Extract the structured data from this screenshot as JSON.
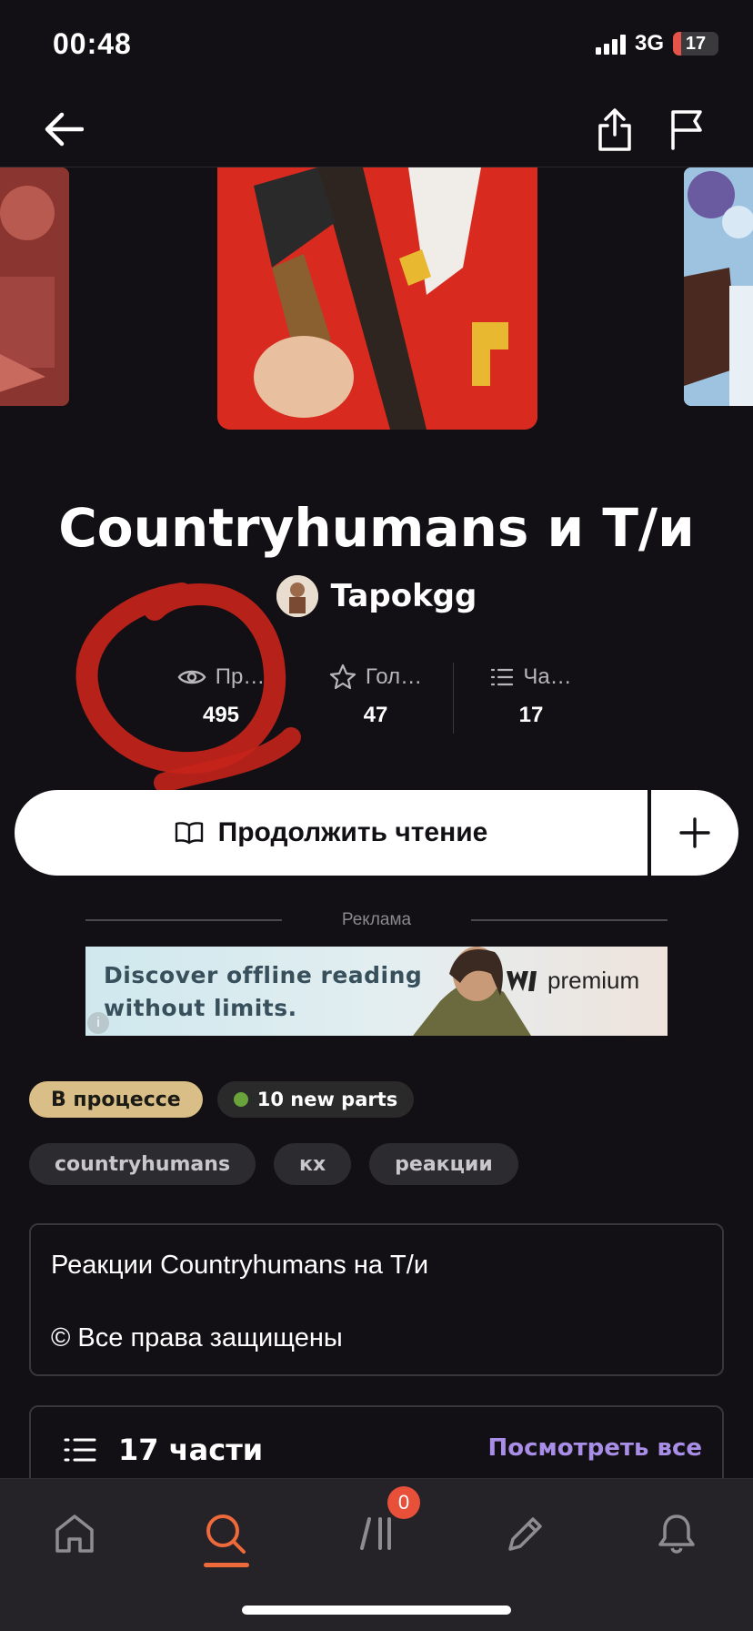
{
  "status_bar": {
    "time": "00:48",
    "network": "3G",
    "battery": "17",
    "battery_level": 0.17
  },
  "story": {
    "title": "Countryhumans и Т/и",
    "author": "Tapokgg"
  },
  "stats": [
    {
      "icon": "eye-icon",
      "label": "Пр…",
      "value": "495"
    },
    {
      "icon": "star-icon",
      "label": "Гол…",
      "value": "47"
    },
    {
      "icon": "list-icon",
      "label": "Ча…",
      "value": "17"
    }
  ],
  "actions": {
    "read_label": "Продолжить чтение"
  },
  "ad": {
    "label": "Реклама",
    "line1": "Discover offline reading",
    "line2": "without limits.",
    "brand": "premium",
    "info": "i"
  },
  "badges": {
    "status": "В процессе",
    "new_parts": "10 new parts"
  },
  "tags": [
    "countryhumans",
    "кх",
    "реакции"
  ],
  "description": {
    "line1": "Реакции Countryhumans на Т/и",
    "line2": "© Все права защищены"
  },
  "parts": {
    "count_label": "17 части",
    "view_all": "Посмотреть все"
  },
  "tab_bar": {
    "library_badge": "0"
  },
  "colors": {
    "accent": "#ee6a3b",
    "link": "#a98ee8",
    "status_badge": "#d9bf87",
    "new_dot": "#69a33b"
  }
}
